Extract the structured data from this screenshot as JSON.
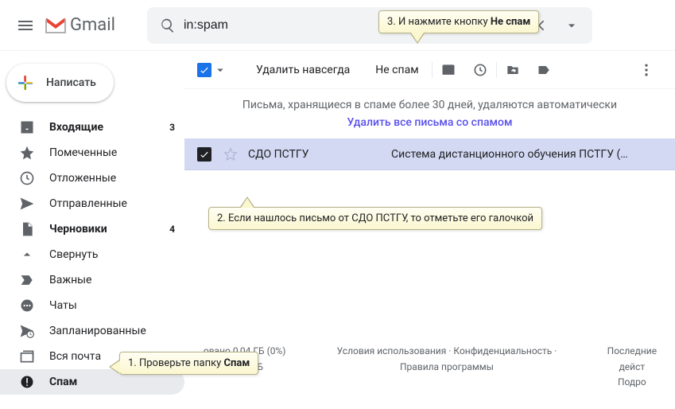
{
  "header": {
    "app_name": "Gmail",
    "search_value": "in:spam"
  },
  "compose_label": "Написать",
  "sidebar": {
    "items": [
      {
        "label": "Входящие",
        "count": "3",
        "bold": true
      },
      {
        "label": "Помеченные"
      },
      {
        "label": "Отложенные"
      },
      {
        "label": "Отправленные"
      },
      {
        "label": "Черновики",
        "count": "4",
        "bold": true
      },
      {
        "label": "Свернуть"
      },
      {
        "label": "Важные"
      },
      {
        "label": "Чаты"
      },
      {
        "label": "Запланированные"
      },
      {
        "label": "Вся почта"
      },
      {
        "label": "Спам",
        "selected": true
      }
    ]
  },
  "toolbar": {
    "delete_forever": "Удалить навсегда",
    "not_spam": "Не спам"
  },
  "notice": {
    "text": "Письма, хранящиеся в спаме более 30 дней, удаляются автоматически",
    "link": "Удалить все письма со спамом"
  },
  "message": {
    "sender": "СДО ПСТГУ",
    "subject": "Система дистанционного обучения ПСТГУ (…"
  },
  "footer": {
    "storage": "овано 0,04 ГБ (0%) из 15 ГБ",
    "terms": "Условия использования",
    "privacy": "Конфиденциальность",
    "program": "Правила программы",
    "recent": "Последние дейст",
    "details": "Подро"
  },
  "callouts": {
    "c1_prefix": "1. Проверьте папку ",
    "c1_bold": "Спам",
    "c2": "2. Если нашлось письмо от СДО ПСТГУ, то отметьте его галочкой",
    "c3_prefix": "3. И нажмите кнопку ",
    "c3_bold": "Не спам"
  }
}
